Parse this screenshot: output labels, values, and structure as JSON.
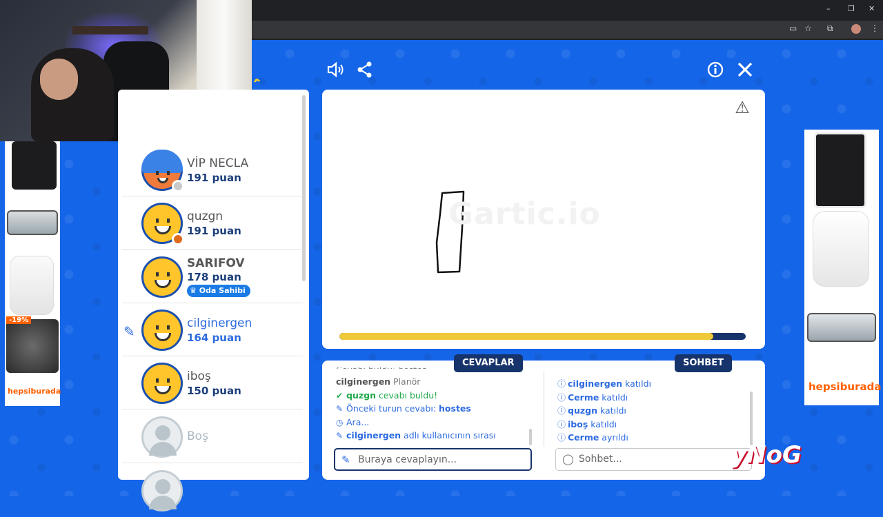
{
  "browser": {
    "window_controls": [
      "–",
      "❐",
      "✕"
    ],
    "toolbar_icons": [
      "cast-icon",
      "star-icon",
      "extensions-icon",
      "profile-avatar",
      "menu-icon"
    ]
  },
  "game": {
    "logo_fragment": "ꞈ",
    "players": [
      {
        "name": "VİP NECLA",
        "points": "191 puan",
        "avatar": "girl",
        "status_color": "#c9c9c9"
      },
      {
        "name": "quzgn",
        "points": "191 puan",
        "avatar": "smiley",
        "status_color": "#e06a1b"
      },
      {
        "name": "SARIFOV",
        "points": "178 puan",
        "avatar": "smiley",
        "badge": "Oda Sahibi"
      },
      {
        "name": "cilginergen",
        "points": "164 puan",
        "avatar": "smiley",
        "drawing": true
      },
      {
        "name": "iboş",
        "points": "150 puan",
        "avatar": "smiley"
      },
      {
        "name": "Boş",
        "points": "",
        "avatar": "empty"
      }
    ],
    "canvas_watermark": "Gartic.io",
    "progress": 0.92,
    "tabs": {
      "answers": "CEVAPLAR",
      "chat": "SOHBET"
    },
    "answers": [
      {
        "type": "grey",
        "user": "cilginergen",
        "text": " Planör"
      },
      {
        "type": "green",
        "user": "quzgn",
        "text": " cevabı buldu!"
      },
      {
        "type": "info",
        "text": "Önceki turun cevabı: ",
        "bold": "hostes"
      },
      {
        "type": "info",
        "text": "Ara..."
      },
      {
        "type": "info",
        "bold": "cilginergen",
        "text": " adlı kullanıcının sırası"
      }
    ],
    "chat": [
      {
        "user": "cilginergen",
        "text": " katıldı"
      },
      {
        "user": "Cerme",
        "text": " katıldı"
      },
      {
        "user": "quzgn",
        "text": " katıldı"
      },
      {
        "user": "iboş",
        "text": " katıldı"
      },
      {
        "user": "Cerme",
        "text": " ayrıldı"
      }
    ],
    "answer_placeholder": "Buraya cevaplayın...",
    "chat_placeholder": "Sohbet..."
  },
  "ads": {
    "store": "hepsiburada",
    "discount": "-19%"
  },
  "overlay": {
    "brand_fragment": "yNoG"
  }
}
